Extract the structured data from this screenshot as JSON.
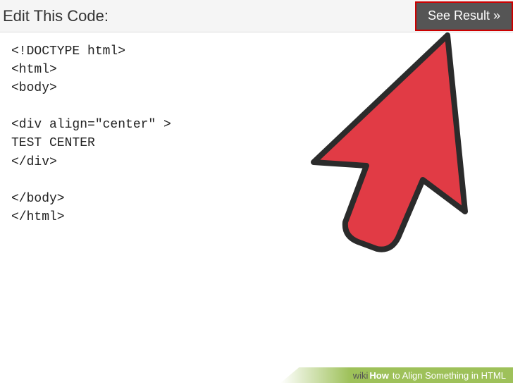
{
  "header": {
    "title": "Edit This Code:",
    "button_label": "See Result »"
  },
  "code": {
    "content": "<!DOCTYPE html>\n<html>\n<body>\n\n<div align=\"center\" >\nTEST CENTER\n</div>\n\n</body>\n</html>"
  },
  "watermark": {
    "prefix": "wiki",
    "brand": "How",
    "article": "to Align Something in HTML"
  },
  "colors": {
    "cursor_fill": "#e13b45",
    "cursor_stroke": "#2b2b2b",
    "button_border": "#cc0000",
    "bar_green": "#8db63d"
  }
}
